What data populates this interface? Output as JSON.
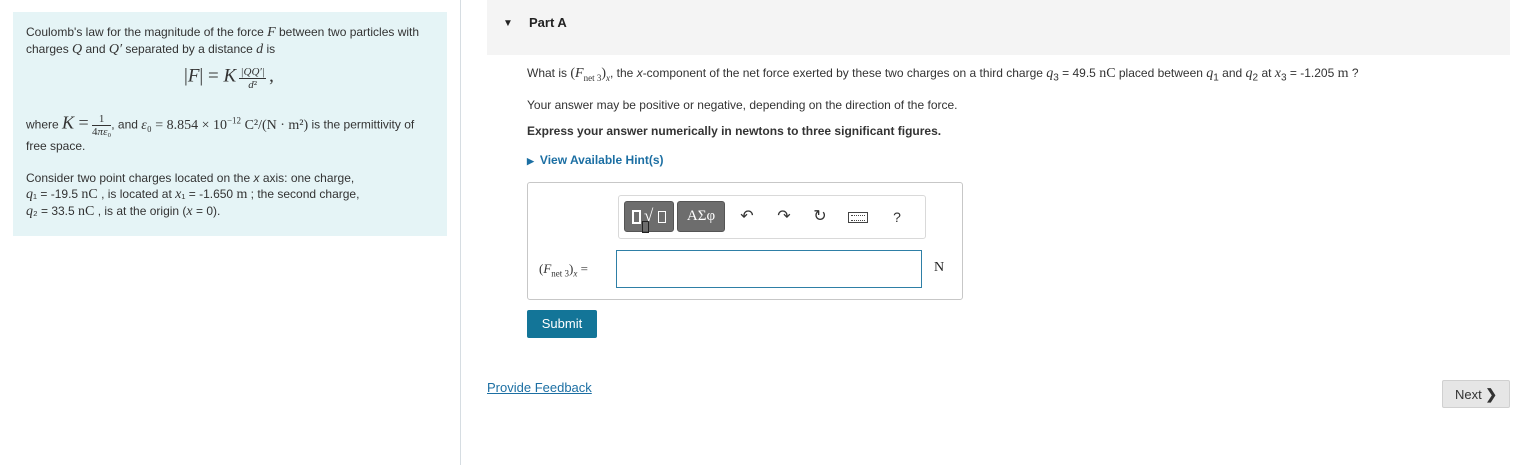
{
  "info": {
    "intro": "Coulomb's law for the magnitude of the force F between two particles with charges Q and Q′ separated by a distance d is",
    "formula": "|F| = K |QQ′| / d²",
    "where_prefix": "where",
    "K_def": "K = 1/(4πε₀)",
    "eps_def": "ε₀ = 8.854 × 10⁻¹² C²/(N·m²)",
    "permittivity_note": "is the permittivity of free space.",
    "consider": "Consider two point charges located on the x axis: one charge,",
    "charge1": "q₁ = -19.5 nC , is located at x₁ = -1.650 m ; the second charge,",
    "charge2": "q₂ = 33.5 nC , is at the origin (x = 0)."
  },
  "part": {
    "title": "Part A",
    "caret": "▼"
  },
  "question": {
    "lead": "What is",
    "quantity": "(Fnet 3)x",
    "rest": ", the x-component of the net force exerted by these two charges on a third charge",
    "q3": "q₃ = 49.5 nC",
    "placed": "placed between q₁ and q₂ at",
    "x3": "x₃ = -1.205 m",
    "end": "?",
    "sign_note": "Your answer may be positive or negative, depending on the direction of the force.",
    "express": "Express your answer numerically in newtons to three significant figures.",
    "hint": "View Available Hint(s)"
  },
  "answer": {
    "label": "(Fnet 3)x =",
    "value": "",
    "unit": "N",
    "toolbar": {
      "templates": "templates-icon",
      "symbols": "ΑΣφ",
      "undo": "↶",
      "redo": "↷",
      "reset": "↻",
      "keyboard": "keyboard-icon",
      "help": "?"
    }
  },
  "submit_label": "Submit",
  "feedback_label": "Provide Feedback",
  "next_label": "Next",
  "colors": {
    "info_bg": "#e5f4f6",
    "accent": "#137598",
    "link": "#1c6fa3"
  }
}
